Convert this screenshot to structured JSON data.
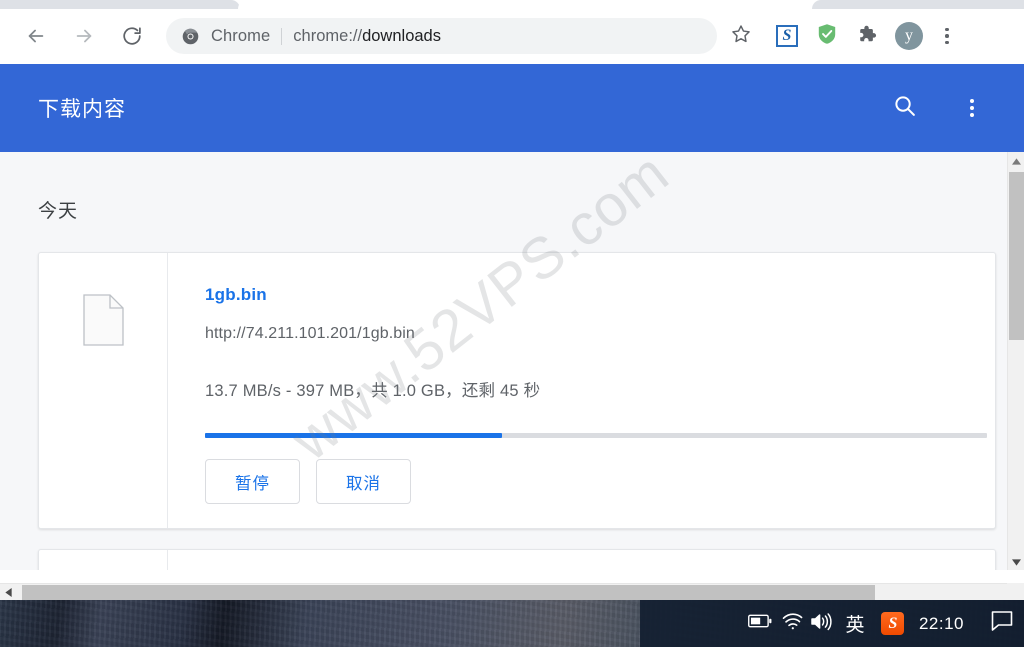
{
  "browser": {
    "nav": {
      "back_label": "Back",
      "forward_label": "Forward",
      "reload_label": "Reload"
    },
    "omnibox": {
      "chip_label": "Chrome",
      "url_scheme": "chrome://",
      "url_path": "downloads",
      "url_full": "chrome://downloads",
      "chrome_icon": "chrome-logo-icon"
    },
    "toolbar_icons": [
      {
        "name": "bookmark-star-icon",
        "label": "☆"
      },
      {
        "name": "sogou-extension-icon",
        "label": "S"
      },
      {
        "name": "adguard-shield-icon",
        "label": "shield"
      },
      {
        "name": "extensions-puzzle-icon",
        "label": "puzzle"
      },
      {
        "name": "profile-avatar",
        "label": "y"
      },
      {
        "name": "chrome-menu-icon",
        "label": "⋮"
      }
    ]
  },
  "downloads_page": {
    "title": "下载内容",
    "search_icon": "search-icon",
    "menu_icon": "more-vert-icon",
    "header_color": "#3367d6",
    "section_label": "今天",
    "items": [
      {
        "file_name": "1gb.bin",
        "file_url": "http://74.211.101.201/1gb.bin",
        "status": "13.7 MB/s - 397 MB，共 1.0 GB，还剩 45 秒",
        "speed": "13.7 MB/s",
        "downloaded": "397 MB",
        "total_size": "1.0 GB",
        "time_remaining": "45 秒",
        "progress_percent": 38,
        "link_color": "#1a73e8",
        "progress_color": "#1a73e8",
        "buttons": [
          {
            "name": "pause-button",
            "label": "暂停"
          },
          {
            "name": "cancel-button",
            "label": "取消"
          }
        ]
      }
    ]
  },
  "watermark": {
    "text": "www.52VPS.com"
  },
  "scrollbars": {
    "vertical_thumb_percent": 40,
    "horizontal_thumb_percent": 84
  },
  "taskbar": {
    "battery_icon": "battery-icon",
    "wifi_icon": "wifi-icon",
    "volume_icon": "volume-icon",
    "ime_label": "英",
    "sogou_label": "S",
    "clock": "22:10",
    "notification_icon": "notification-bubble-icon"
  }
}
